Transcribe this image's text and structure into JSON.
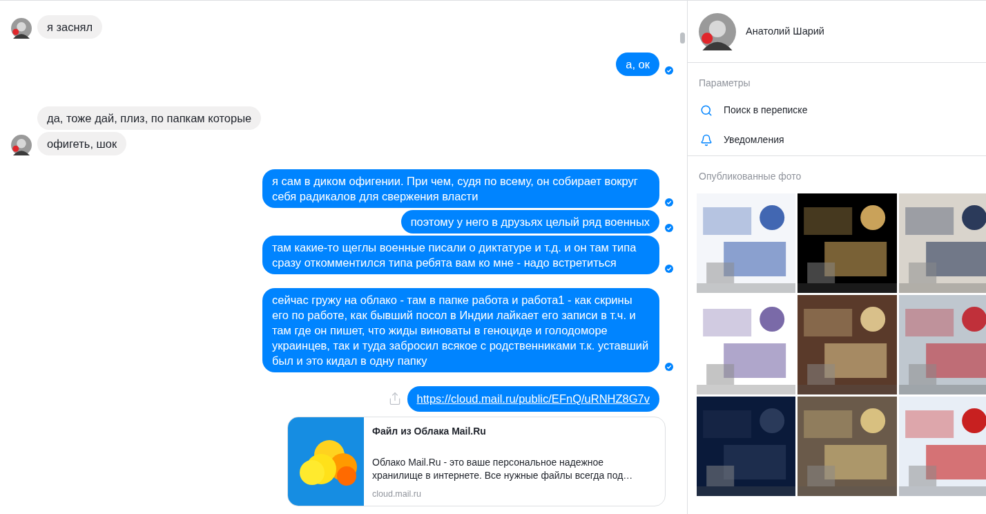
{
  "groups": [
    {
      "kind": "incoming",
      "messages": [
        {
          "text": "я заснял"
        }
      ]
    },
    {
      "kind": "outgoing",
      "messages": [
        {
          "text": "а, ок",
          "read": true
        }
      ]
    },
    {
      "kind": "incoming",
      "messages": [
        {
          "text": "да, тоже дай, плиз, по папкам которые"
        },
        {
          "text": "офигеть, шок"
        }
      ]
    },
    {
      "kind": "outgoing",
      "messages": [
        {
          "text": "я сам в диком офигении. При чем, судя по всему, он собирает вокруг себя радикалов для свержения власти",
          "read": true
        },
        {
          "text": "поэтому у него в друзьях целый ряд военных",
          "read": true
        },
        {
          "text": "там какие-то щеглы военные писали о диктатуре и т.д. и он там типа сразу откомментился типа ребята вам ко мне - надо встретиться",
          "read": true
        }
      ]
    },
    {
      "kind": "outgoing",
      "messages": [
        {
          "text": "сейчас гружу на облако - там в папке работа и работа1 - как скрины его по работе, как бывший посол в Индии лайкает его записи в т.ч. и там где он пишет, что жиды виноваты в геноциде и голодоморе украинцев, так и туда забросил всякое с родственниками т.к. уставший был и это кидал в одну папку",
          "read": true
        }
      ]
    }
  ],
  "link_message": {
    "url": "https://cloud.mail.ru/public/EFnQ/uRNHZ8G7v",
    "preview": {
      "title": "Файл из Облака Mail.Ru",
      "description": "Облако Mail.Ru - это ваше персональное надежное хранилище в интернете. Все нужные файлы всегда под…",
      "domain": "cloud.mail.ru"
    }
  },
  "sidebar": {
    "contact_name": "Анатолий Шарий",
    "options_title": "Параметры",
    "options": [
      {
        "kind": "search",
        "label": "Поиск в переписке"
      },
      {
        "kind": "bell",
        "label": "Уведомления"
      }
    ],
    "photos_title": "Опубликованные фото"
  }
}
